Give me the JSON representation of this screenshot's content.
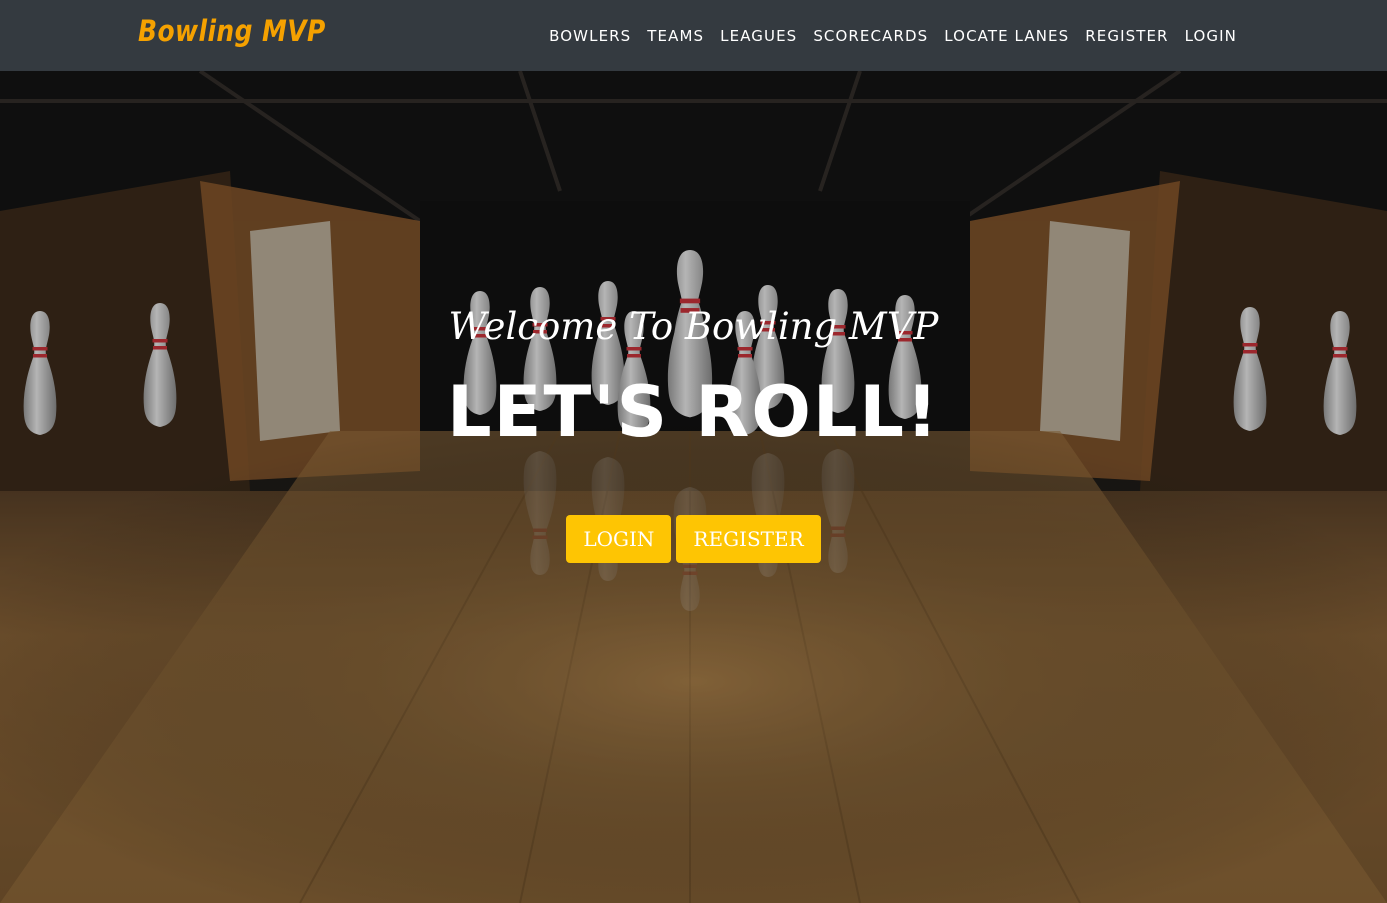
{
  "brand": {
    "name": "Bowling MVP",
    "color": "#f5a100"
  },
  "nav": {
    "items": [
      {
        "label": "BOWLERS"
      },
      {
        "label": "TEAMS"
      },
      {
        "label": "LEAGUES"
      },
      {
        "label": "SCORECARDS"
      },
      {
        "label": "LOCATE LANES"
      },
      {
        "label": "REGISTER"
      },
      {
        "label": "LOGIN"
      }
    ]
  },
  "hero": {
    "subheading": "Welcome To Bowling MVP",
    "heading": "LET'S ROLL!",
    "buttons": {
      "login_label": "LOGIN",
      "register_label": "REGISTER"
    },
    "button_color": "#fec503",
    "background_image": "bowling-lane-with-pins"
  }
}
